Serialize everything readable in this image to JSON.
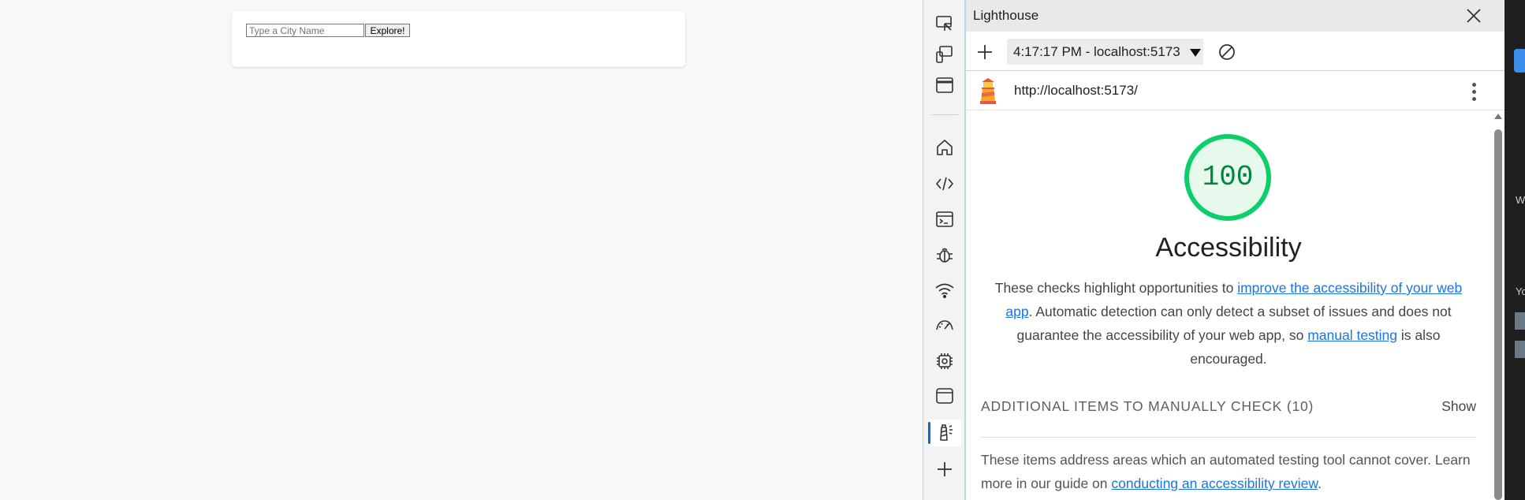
{
  "page": {
    "search_placeholder": "Type a City Name",
    "search_value": "",
    "explore_label": "Explore!"
  },
  "activity_bar": {
    "items": [
      {
        "icon": "inspect-element-icon"
      },
      {
        "icon": "device-emulation-icon"
      },
      {
        "icon": "window-icon"
      },
      {
        "icon": "welcome-home-icon"
      },
      {
        "icon": "elements-code-icon"
      },
      {
        "icon": "console-icon"
      },
      {
        "icon": "sources-debug-icon"
      },
      {
        "icon": "network-wifi-icon"
      },
      {
        "icon": "performance-gauge-icon"
      },
      {
        "icon": "memory-chip-icon"
      },
      {
        "icon": "application-icon"
      },
      {
        "icon": "lighthouse-icon",
        "selected": true
      },
      {
        "icon": "more-tools-plus-icon"
      }
    ]
  },
  "panel": {
    "title": "Lighthouse",
    "report_selector": "4:17:17 PM - localhost:5173",
    "url": "http://localhost:5173/",
    "score": "100",
    "score_color": "#0cce6b",
    "category_title": "Accessibility",
    "description": {
      "part1": "These checks highlight opportunities to ",
      "link1": "improve the accessibility of your web app",
      "part2": ". Automatic detection can only detect a subset of issues and does not guarantee the accessibility of your web app, so ",
      "link2": "manual testing",
      "part3": " is also encouraged."
    },
    "manual_check": {
      "title": "ADDITIONAL ITEMS TO MANUALLY CHECK",
      "count": "(10)",
      "show_label": "Show",
      "desc_text": "These items address areas which an automated testing tool cannot cover. Learn more in our guide on ",
      "desc_link": "conducting an accessibility review",
      "desc_end": "."
    }
  },
  "edge_strip": {
    "letters": [
      "W",
      "Yo"
    ]
  }
}
